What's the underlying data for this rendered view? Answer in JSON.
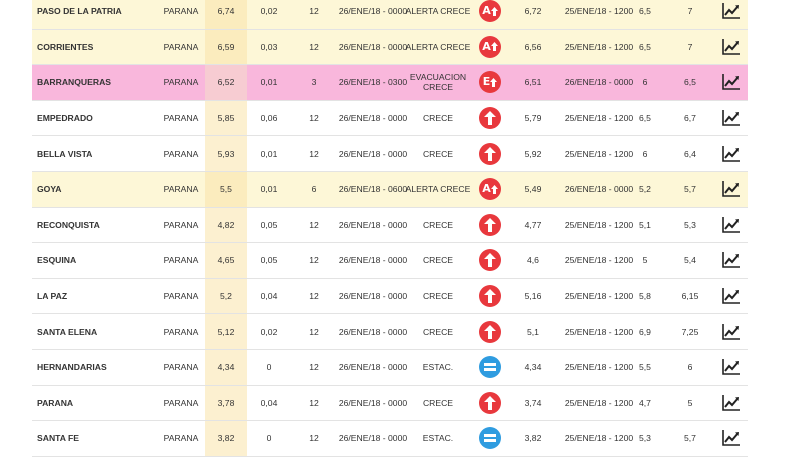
{
  "colors": {
    "alert_row": "#fdf7d7",
    "evac_row": "#f9b7dc",
    "icon_red": "#e8383d",
    "icon_blue": "#2f9ce0"
  },
  "rows": [
    {
      "status": "alert",
      "name": "PASO DE LA PATRIA",
      "river": "PARANA",
      "level": "6,74",
      "variation": "0,02",
      "period": "12",
      "date": "26/ENE/18 - 0000",
      "trend": "ALERTA CRECE",
      "icon": "alert-rising-icon",
      "prev_level": "6,72",
      "prev_date": "25/ENE/18 - 1200",
      "alert_level": "6,5",
      "evac_level": "7"
    },
    {
      "status": "alert",
      "name": "CORRIENTES",
      "river": "PARANA",
      "level": "6,59",
      "variation": "0,03",
      "period": "12",
      "date": "26/ENE/18 - 0000",
      "trend": "ALERTA CRECE",
      "icon": "alert-rising-icon",
      "prev_level": "6,56",
      "prev_date": "25/ENE/18 - 1200",
      "alert_level": "6,5",
      "evac_level": "7"
    },
    {
      "status": "evac",
      "name": "BARRANQUERAS",
      "river": "PARANA",
      "level": "6,52",
      "variation": "0,01",
      "period": "3",
      "date": "26/ENE/18 - 0300",
      "trend": "EVACUACION CRECE",
      "icon": "evacuation-rising-icon",
      "prev_level": "6,51",
      "prev_date": "26/ENE/18 - 0000",
      "alert_level": "6",
      "evac_level": "6,5"
    },
    {
      "status": "normal",
      "name": "EMPEDRADO",
      "river": "PARANA",
      "level": "5,85",
      "variation": "0,06",
      "period": "12",
      "date": "26/ENE/18 - 0000",
      "trend": "CRECE",
      "icon": "rising-icon",
      "prev_level": "5,79",
      "prev_date": "25/ENE/18 - 1200",
      "alert_level": "6,5",
      "evac_level": "6,7"
    },
    {
      "status": "normal",
      "name": "BELLA VISTA",
      "river": "PARANA",
      "level": "5,93",
      "variation": "0,01",
      "period": "12",
      "date": "26/ENE/18 - 0000",
      "trend": "CRECE",
      "icon": "rising-icon",
      "prev_level": "5,92",
      "prev_date": "25/ENE/18 - 1200",
      "alert_level": "6",
      "evac_level": "6,4"
    },
    {
      "status": "alert",
      "name": "GOYA",
      "river": "PARANA",
      "level": "5,5",
      "variation": "0,01",
      "period": "6",
      "date": "26/ENE/18 - 0600",
      "trend": "ALERTA CRECE",
      "icon": "alert-rising-icon",
      "prev_level": "5,49",
      "prev_date": "26/ENE/18 - 0000",
      "alert_level": "5,2",
      "evac_level": "5,7"
    },
    {
      "status": "normal",
      "name": "RECONQUISTA",
      "river": "PARANA",
      "level": "4,82",
      "variation": "0,05",
      "period": "12",
      "date": "26/ENE/18 - 0000",
      "trend": "CRECE",
      "icon": "rising-icon",
      "prev_level": "4,77",
      "prev_date": "25/ENE/18 - 1200",
      "alert_level": "5,1",
      "evac_level": "5,3"
    },
    {
      "status": "normal",
      "name": "ESQUINA",
      "river": "PARANA",
      "level": "4,65",
      "variation": "0,05",
      "period": "12",
      "date": "26/ENE/18 - 0000",
      "trend": "CRECE",
      "icon": "rising-icon",
      "prev_level": "4,6",
      "prev_date": "25/ENE/18 - 1200",
      "alert_level": "5",
      "evac_level": "5,4"
    },
    {
      "status": "normal",
      "name": "LA PAZ",
      "river": "PARANA",
      "level": "5,2",
      "variation": "0,04",
      "period": "12",
      "date": "26/ENE/18 - 0000",
      "trend": "CRECE",
      "icon": "rising-icon",
      "prev_level": "5,16",
      "prev_date": "25/ENE/18 - 1200",
      "alert_level": "5,8",
      "evac_level": "6,15"
    },
    {
      "status": "normal",
      "name": "SANTA ELENA",
      "river": "PARANA",
      "level": "5,12",
      "variation": "0,02",
      "period": "12",
      "date": "26/ENE/18 - 0000",
      "trend": "CRECE",
      "icon": "rising-icon",
      "prev_level": "5,1",
      "prev_date": "25/ENE/18 - 1200",
      "alert_level": "6,9",
      "evac_level": "7,25"
    },
    {
      "status": "normal",
      "name": "HERNANDARIAS",
      "river": "PARANA",
      "level": "4,34",
      "variation": "0",
      "period": "12",
      "date": "26/ENE/18 - 0000",
      "trend": "ESTAC.",
      "icon": "stationary-icon",
      "prev_level": "4,34",
      "prev_date": "25/ENE/18 - 1200",
      "alert_level": "5,5",
      "evac_level": "6"
    },
    {
      "status": "normal",
      "name": "PARANA",
      "river": "PARANA",
      "level": "3,78",
      "variation": "0,04",
      "period": "12",
      "date": "26/ENE/18 - 0000",
      "trend": "CRECE",
      "icon": "rising-icon",
      "prev_level": "3,74",
      "prev_date": "25/ENE/18 - 1200",
      "alert_level": "4,7",
      "evac_level": "5"
    },
    {
      "status": "normal",
      "name": "SANTA FE",
      "river": "PARANA",
      "level": "3,82",
      "variation": "0",
      "period": "12",
      "date": "26/ENE/18 - 0000",
      "trend": "ESTAC.",
      "icon": "stationary-icon",
      "prev_level": "3,82",
      "prev_date": "25/ENE/18 - 1200",
      "alert_level": "5,3",
      "evac_level": "5,7"
    }
  ]
}
